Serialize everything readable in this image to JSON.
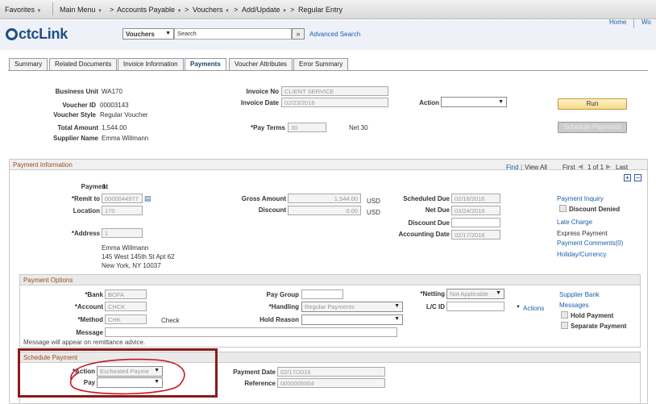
{
  "nav": {
    "favorites": "Favorites",
    "main_menu": "Main Menu",
    "accounts_payable": "Accounts Payable",
    "vouchers": "Vouchers",
    "add_update": "Add/Update",
    "regular_entry": "Regular Entry",
    "sep": ">",
    "home": "Home",
    "wo": "Wo"
  },
  "brand": {
    "logo": "ctcLink",
    "search_scope": "Vouchers",
    "search_placeholder": "Search",
    "search_go": "»",
    "advanced_search": "Advanced Search"
  },
  "tabs": [
    "Summary",
    "Related Documents",
    "Invoice Information",
    "Payments",
    "Voucher Attributes",
    "Error Summary"
  ],
  "header": {
    "business_unit_label": "Business Unit",
    "business_unit": "WA170",
    "voucher_id_label": "Voucher ID",
    "voucher_id": "00003143",
    "voucher_style_label": "Voucher Style",
    "voucher_style": "Regular Voucher",
    "total_amount_label": "Total Amount",
    "total_amount": "1,544.00",
    "supplier_name_label": "Supplier Name",
    "supplier_name": "Emma Willmann",
    "invoice_no_label": "Invoice No",
    "invoice_no": "CLIENT SERVICE",
    "invoice_date_label": "Invoice Date",
    "invoice_date": "02/23/2016",
    "pay_terms_label": "*Pay Terms",
    "pay_terms": "30",
    "pay_terms_desc": "Net 30",
    "action_label": "Action",
    "action_value": "",
    "run": "Run",
    "schedule_payments": "Schedule Payments"
  },
  "payment_info": {
    "title": "Payment Information",
    "find": "Find",
    "view_all": "View All",
    "first": "First",
    "pager": "1 of 1",
    "last": "Last",
    "payment_label": "Payment",
    "payment_no": "1",
    "remit_to_label": "*Remit to",
    "remit_to": "0000044977",
    "location_label": "Location",
    "location": "170",
    "address_label": "*Address",
    "address": "1",
    "addr_line1": "Emma Willmann",
    "addr_line2": "145 West 145th St Apt 62",
    "addr_line3": "New York, NY  10037",
    "gross_amount_label": "Gross Amount",
    "gross_amount": "1,544.00",
    "currency1": "USD",
    "discount_label": "Discount",
    "discount": "0.00",
    "currency2": "USD",
    "scheduled_due_label": "Scheduled Due",
    "scheduled_due": "02/16/2016",
    "net_due_label": "Net Due",
    "net_due": "03/24/2016",
    "discount_due_label": "Discount Due",
    "discount_due": "",
    "accounting_date_label": "Accounting Date",
    "accounting_date": "02/17/2016",
    "payment_inquiry": "Payment Inquiry",
    "discount_denied": "Discount Denied",
    "late_charge": "Late Charge",
    "express_payment": "Express Payment",
    "payment_comments": "Payment Comments(0)",
    "holiday_currency": "Holiday/Currency"
  },
  "payment_options": {
    "title": "Payment Options",
    "bank_label": "*Bank",
    "bank": "BOFA",
    "account_label": "*Account",
    "account": "CHCK",
    "method_label": "*Method",
    "method": "CHK",
    "method_desc": "Check",
    "message_label": "Message",
    "message": "",
    "remit_note": "Message will appear on remittance advice.",
    "pay_group_label": "Pay Group",
    "pay_group": "",
    "handling_label": "*Handling",
    "handling": "Regular Payments",
    "hold_reason_label": "Hold Reason",
    "hold_reason": "",
    "netting_label": "*Netting",
    "netting": "Not Applicable",
    "lc_id_label": "L/C ID",
    "lc_id": "",
    "actions": "Actions",
    "supplier_bank": "Supplier Bank",
    "messages": "Messages",
    "hold_payment": "Hold Payment",
    "separate_payment": "Separate Payment"
  },
  "schedule_payment": {
    "title": "Schedule Payment",
    "action_label": "*Action",
    "action": "Escheated Payme",
    "pay_label": "Pay",
    "pay": "",
    "payment_date_label": "Payment Date",
    "payment_date": "02/17/2016",
    "reference_label": "Reference",
    "reference": "0000005004"
  },
  "colors": {
    "annotation": "#8b1a1a",
    "accent": "#1a5fa8",
    "section_title": "#9c4a1e"
  }
}
